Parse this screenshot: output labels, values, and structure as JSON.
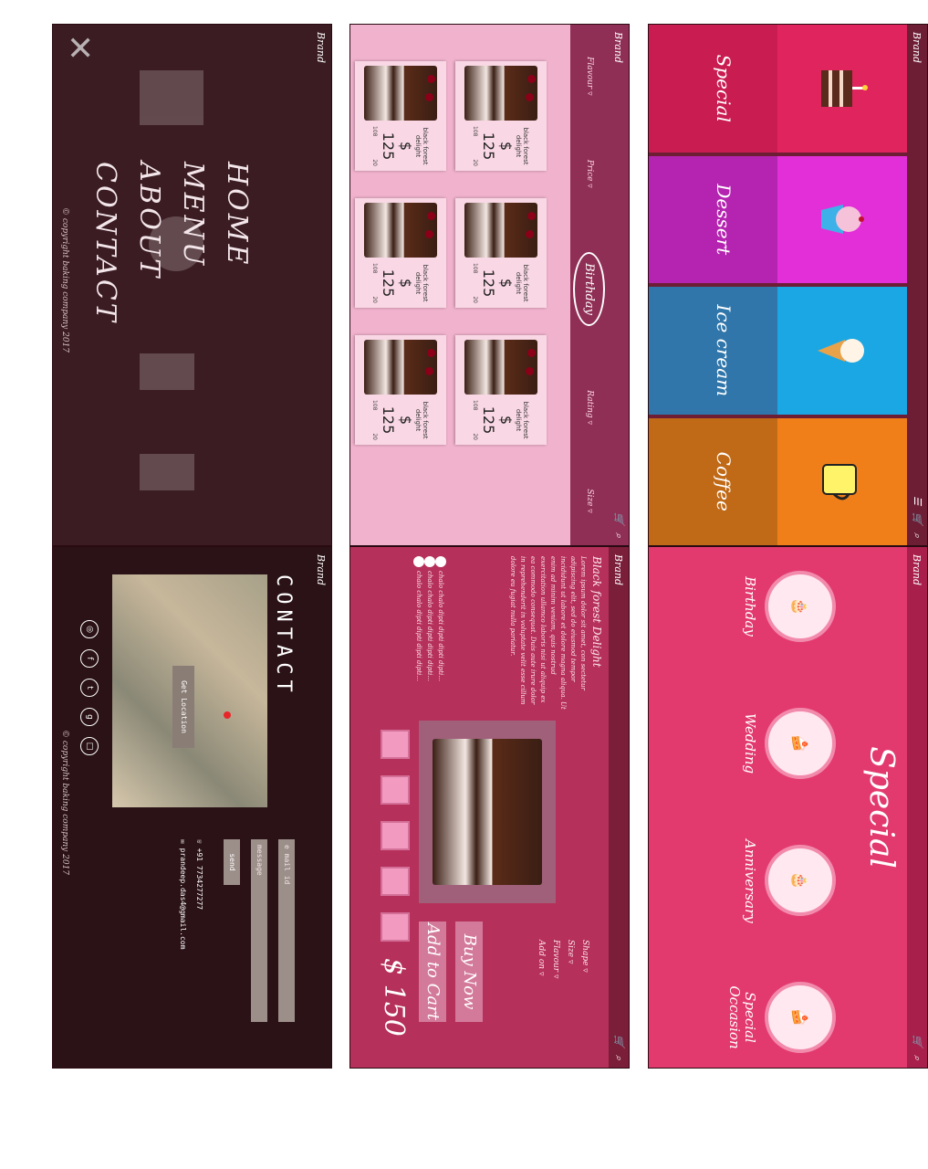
{
  "brand": "Brand",
  "copyright": "© copyright baking company 2017",
  "categories": [
    {
      "label": "Special",
      "top": "#e0245e",
      "bottom": "#c91d52",
      "icon": "layer-cake-icon"
    },
    {
      "label": "Dessert",
      "top": "#e32fd7",
      "bottom": "#b424b0",
      "icon": "cupcake-icon"
    },
    {
      "label": "Ice cream",
      "top": "#1aa7e4",
      "bottom": "#3076aa",
      "icon": "ice-cream-cone-icon"
    },
    {
      "label": "Coffee",
      "top": "#f07f1a",
      "bottom": "#c06a17",
      "icon": "coffee-cup-icon"
    }
  ],
  "filters": {
    "flavour": "Flavour ▿",
    "price": "Price ▿",
    "active": "Birthday",
    "rating": "Rating ▿",
    "size": "Size ▿"
  },
  "products": [
    {
      "name": "black forest delight",
      "price": "$ 125",
      "likes": "108",
      "comments": "20"
    },
    {
      "name": "black forest delight",
      "price": "$ 125",
      "likes": "108",
      "comments": "20"
    },
    {
      "name": "black forest delight",
      "price": "$ 125",
      "likes": "108",
      "comments": "20"
    },
    {
      "name": "black forest delight",
      "price": "$ 125",
      "likes": "108",
      "comments": "20"
    },
    {
      "name": "black forest delight",
      "price": "$ 125",
      "likes": "108",
      "comments": "20"
    },
    {
      "name": "black forest delight",
      "price": "$ 125",
      "likes": "108",
      "comments": "20"
    }
  ],
  "menu": [
    "HOME",
    "MENU",
    "ABOUT",
    "CONTACT"
  ],
  "special": {
    "title": "Special",
    "items": [
      "Birthday",
      "Wedding",
      "Anniversary",
      "Special Occasion"
    ]
  },
  "detail": {
    "title": "Black forest Delight",
    "description": "Lorem ipsum dolor sit amet, con sectetur adipiscing elit, sed do eiusmod tempor incididunt ut labore et dolore magna aliqua. Ut enim ad minim veniam, quis nostrud exercitation ullamco laboris nisi ut aliquip ex ea commodo consequat. Duis aute irure dolor in reprehenderit in voluptate velit esse cillum dolore eu fugiat nulla pariatur.",
    "options": [
      "Shape ▿",
      "Size ▿",
      "Flavour ▿",
      "Add on ▿"
    ],
    "buy": "Buy Now",
    "cart": "Add to Cart",
    "price": "$ 150",
    "comments": [
      "chalo chalo dipti dipti dipti dipti...",
      "chalo chalo dipti dipti dipti dipti...",
      "chalo chalo dipti dipti dipti dipti..."
    ]
  },
  "contact": {
    "title": "CONTACT",
    "location_btn": "Get Location",
    "email_placeholder": "e mail id",
    "message_placeholder": "message",
    "send": "send",
    "phone": "+91 7734277277",
    "email": "prandeep.das4@gmail.com"
  }
}
